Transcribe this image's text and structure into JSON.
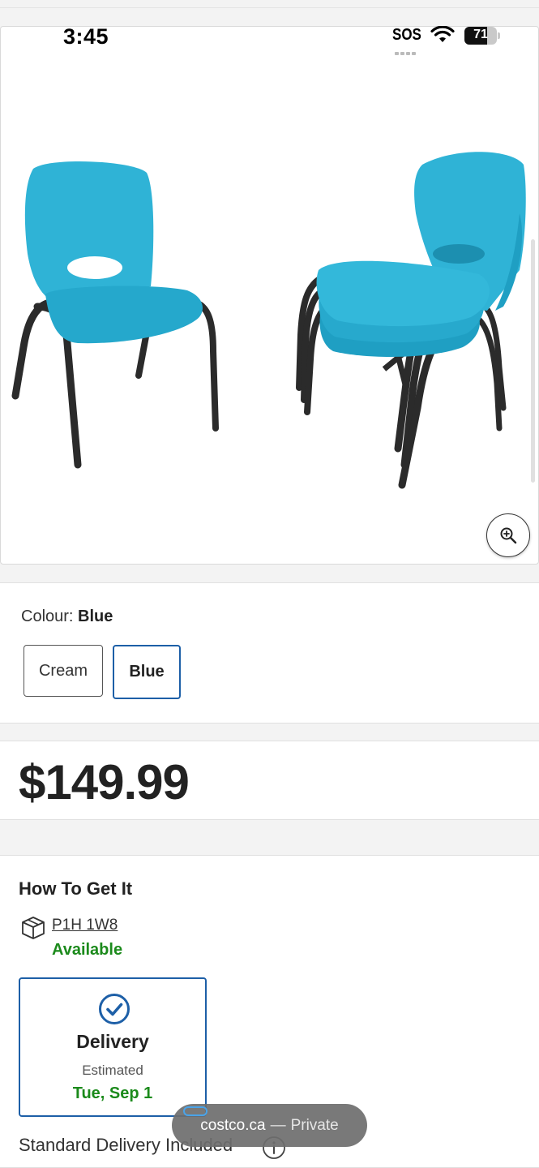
{
  "status_bar": {
    "time": "3:45",
    "carrier": "SOS",
    "battery_level": "71",
    "battery_fraction": 0.71
  },
  "product_image": {
    "alt": "Blue children's stacking chairs",
    "zoom_icon": "zoom-in-icon",
    "seat_color": "#2fb3d6",
    "frame_color": "#2b2b2b"
  },
  "colour": {
    "label": "Colour:",
    "selected": "Blue",
    "options": [
      "Cream",
      "Blue"
    ]
  },
  "price": "$149.99",
  "how_to_get": {
    "title": "How To Get It",
    "postal_code": "P1H 1W8",
    "availability": "Available",
    "delivery": {
      "title": "Delivery",
      "estimated_label": "Estimated",
      "date": "Tue, Sep 1"
    },
    "standard_delivery": "Standard Delivery Included"
  },
  "browser": {
    "domain": "costco.ca",
    "separator": "—",
    "mode": "Private"
  },
  "colors": {
    "accent": "#1d5fa7",
    "success": "#1b8a1b"
  }
}
